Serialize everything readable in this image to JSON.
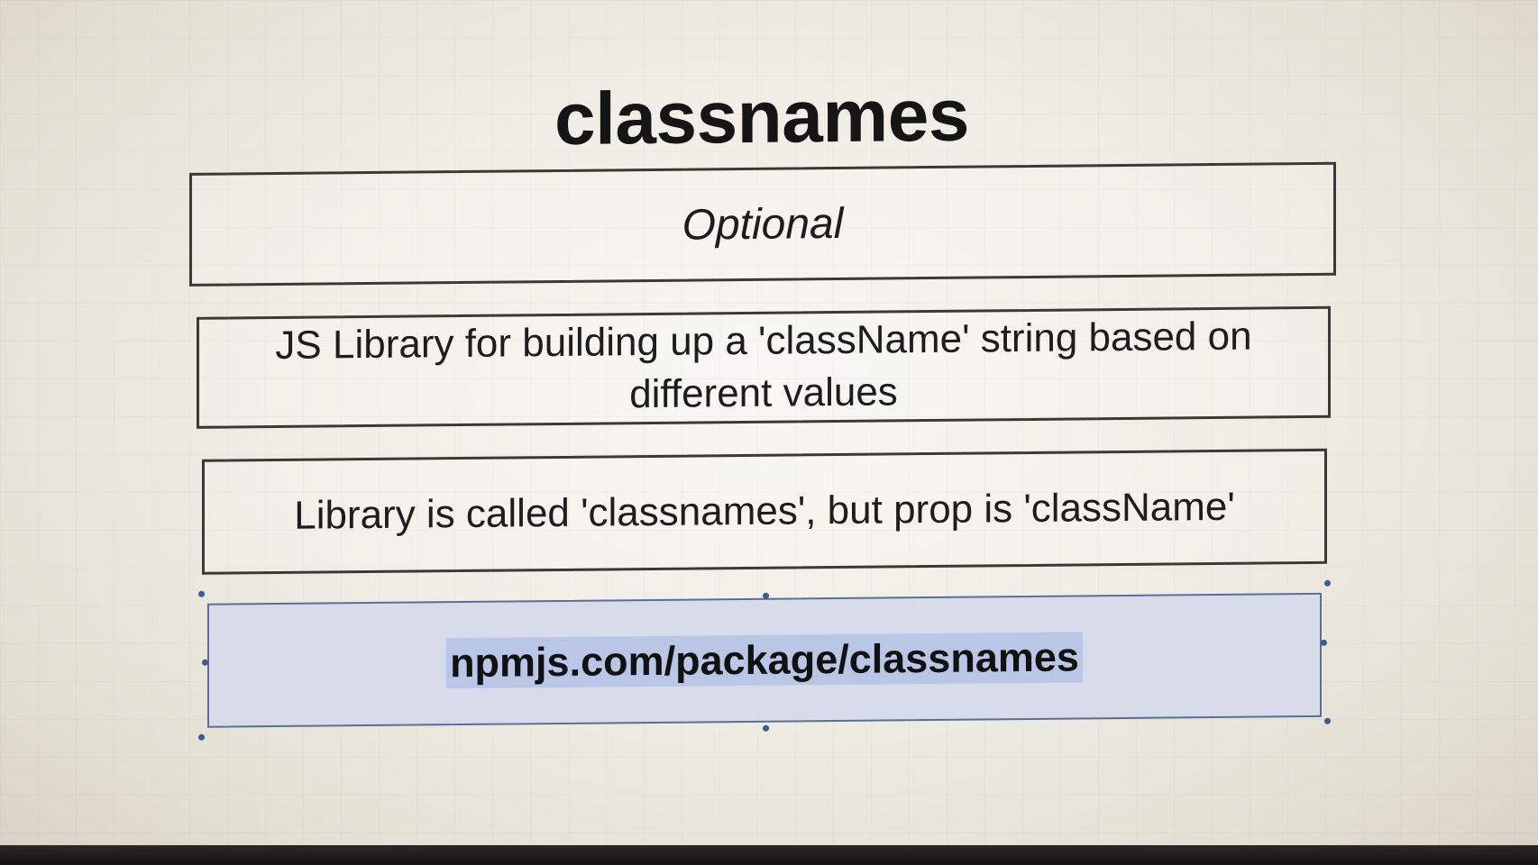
{
  "slide": {
    "title": "classnames",
    "boxes": [
      {
        "text": "Optional"
      },
      {
        "text": "JS Library for building up a 'className' string based on different values"
      },
      {
        "text": "Library is called 'classnames', but prop is 'className'"
      },
      {
        "text": "npmjs.com/package/classnames"
      }
    ]
  },
  "colors": {
    "selection_fill": "#d8dcea",
    "text_highlight": "#b9c6e6",
    "selection_border": "#5a6f95"
  }
}
